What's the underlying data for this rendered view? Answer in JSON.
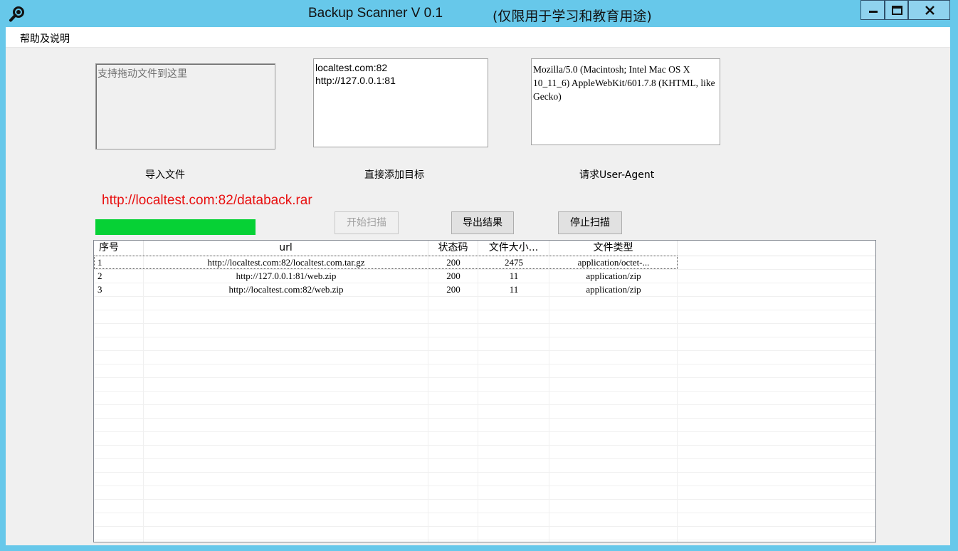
{
  "window": {
    "title": "Backup Scanner V 0.1",
    "title_note": "(仅限用于学习和教育用途)",
    "title_bar_color": "#67c8ea",
    "app_icon": "search-icon"
  },
  "menu": {
    "items": [
      {
        "label": "帮助及说明"
      }
    ]
  },
  "drop_zone": {
    "placeholder": "支持拖动文件到这里",
    "label": "导入文件"
  },
  "targets": {
    "value": "localtest.com:82\nhttp://127.0.0.1:81",
    "label": "直接添加目标"
  },
  "user_agent": {
    "value": "Mozilla/5.0 (Macintosh; Intel Mac OS X 10_11_6) AppleWebKit/601.7.8 (KHTML, like Gecko)",
    "label": "请求User-Agent"
  },
  "scan": {
    "current_url": "http://localtest.com:82/databack.rar",
    "current_url_color": "#e81010",
    "progress": 1.0,
    "progress_color": "#06d135"
  },
  "buttons": {
    "start": "开始扫描",
    "export": "导出结果",
    "stop": "停止扫描"
  },
  "results": {
    "columns": [
      "序号",
      "url",
      "状态码",
      "文件大小...",
      "文件类型"
    ],
    "rows": [
      [
        "1",
        "http://localtest.com:82/localtest.com.tar.gz",
        "200",
        "2475",
        "application/octet-..."
      ],
      [
        "2",
        "http://127.0.0.1:81/web.zip",
        "200",
        "11",
        "application/zip"
      ],
      [
        "3",
        "http://localtest.com:82/web.zip",
        "200",
        "11",
        "application/zip"
      ]
    ]
  }
}
